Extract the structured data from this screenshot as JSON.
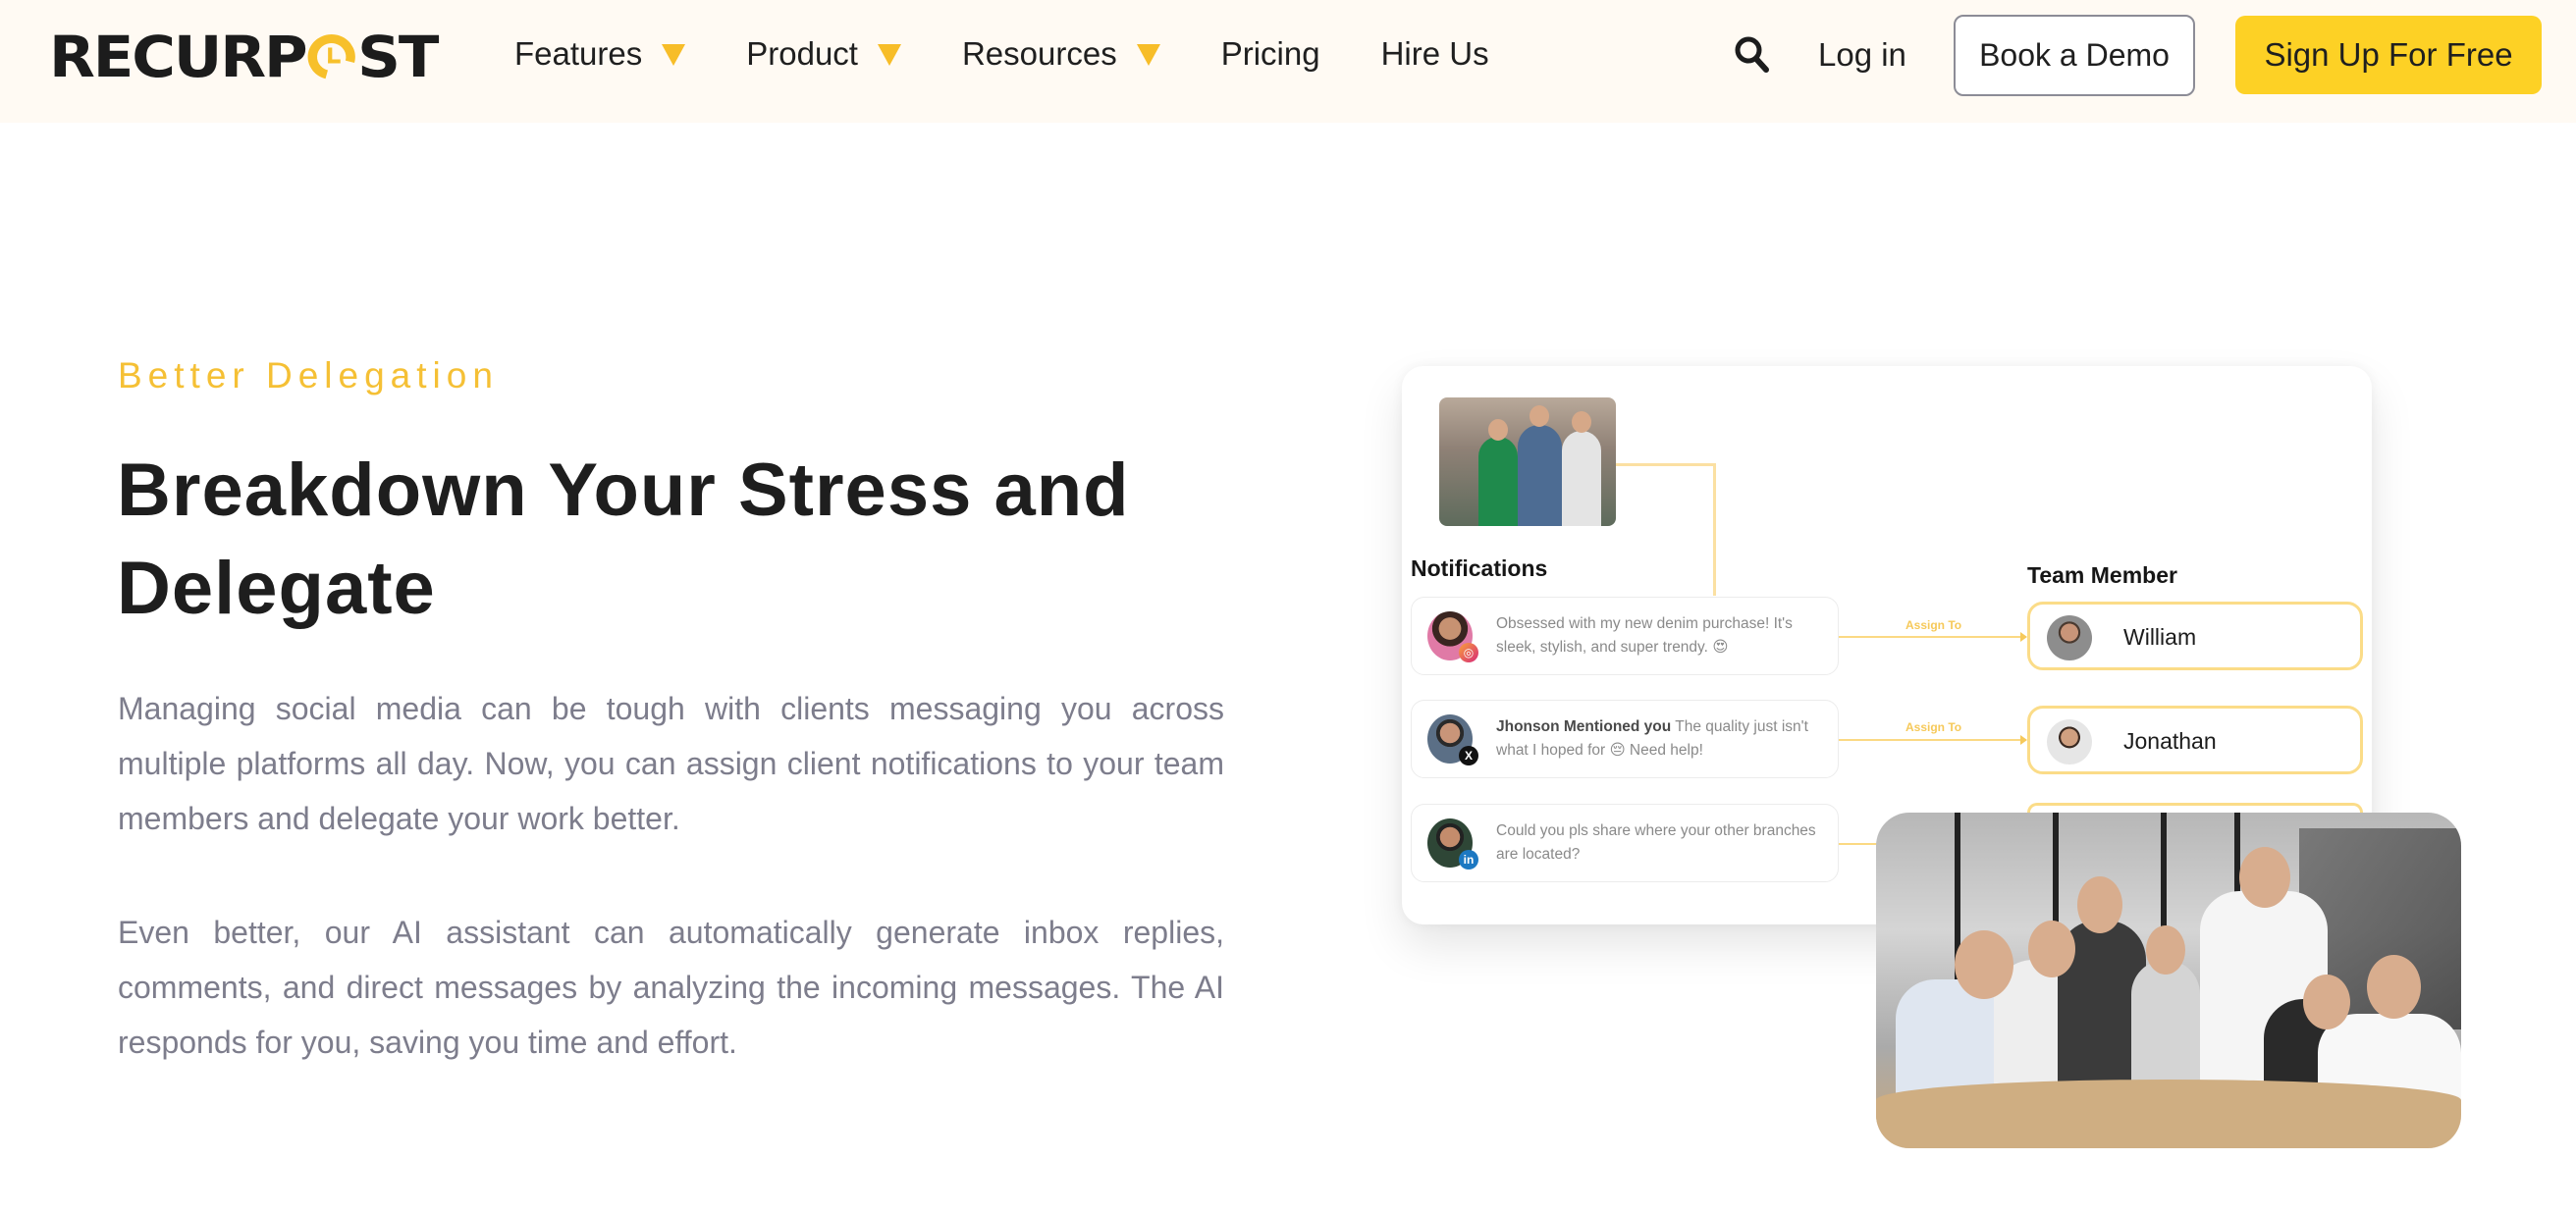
{
  "header": {
    "logo_text_left": "RECURP",
    "logo_text_right": "ST",
    "logo_alt": "RecurPost",
    "nav": [
      {
        "label": "Features",
        "has_dropdown": true
      },
      {
        "label": "Product",
        "has_dropdown": true
      },
      {
        "label": "Resources",
        "has_dropdown": true
      },
      {
        "label": "Pricing",
        "has_dropdown": false
      },
      {
        "label": "Hire Us",
        "has_dropdown": false
      }
    ],
    "search_icon": "search-icon",
    "login_label": "Log in",
    "demo_label": "Book a Demo",
    "signup_label": "Sign Up For Free"
  },
  "section": {
    "eyebrow": "Better Delegation",
    "title": "Breakdown Your Stress and Delegate",
    "paragraphs": [
      "Managing social media can be tough with clients messaging you across multiple platforms all day. Now, you can assign client notifications to your team members and delegate your work better.",
      "Even better, our AI assistant can automatically generate inbox replies, comments, and direct messages by analyzing the incoming messages. The AI responds for you, saving you time and effort."
    ]
  },
  "illustration": {
    "notifications_title": "Notifications",
    "team_title": "Team Member",
    "assign_label": "Assign To",
    "notifications": [
      {
        "platform": "instagram",
        "bold": "",
        "text": "Obsessed with my new denim purchase! It's sleek, stylish, and super trendy. 😍"
      },
      {
        "platform": "x",
        "bold": "Jhonson Mentioned you",
        "text": " The quality just isn't what I hoped for 😔 Need help!"
      },
      {
        "platform": "linkedin",
        "bold": "",
        "text": "Could you pls share where your other branches are located?"
      }
    ],
    "members": [
      {
        "name": "William"
      },
      {
        "name": "Jonathan"
      }
    ]
  },
  "colors": {
    "accent": "#fdd125",
    "eyebrow": "#f5c035",
    "header_bg": "#fffaf3",
    "body_text": "#7d7d8c",
    "connector": "#fbd983"
  }
}
